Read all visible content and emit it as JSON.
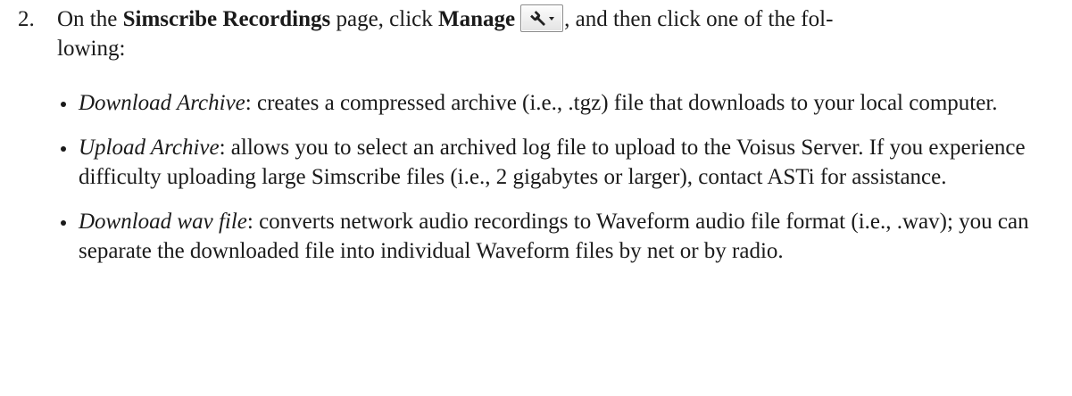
{
  "step": {
    "number": "2.",
    "before_page": "On the ",
    "page_name": "Simscribe Recordings",
    "mid": " page, click ",
    "button_label": "Manage",
    "after_button_line1": ", and then click one of the fol-",
    "after_button_line2": "lowing:",
    "manage_icon": "wrench-dropdown-icon"
  },
  "bullets": [
    {
      "term": "Download Archive",
      "text": ": creates a compressed archive (i.e., .tgz) file that downloads to your local computer."
    },
    {
      "term": "Upload Archive",
      "text": ": allows you to select an archived log file to upload to the Voisus Server. If you experience difficulty uploading large Simscribe files (i.e., 2 gigabytes or larger), contact ASTi for assistance."
    },
    {
      "term": "Download wav file",
      "text": ": converts network audio recordings to Waveform audio file format (i.e., .wav); you can separate the downloaded file into individual Waveform files by net or by radio."
    }
  ]
}
